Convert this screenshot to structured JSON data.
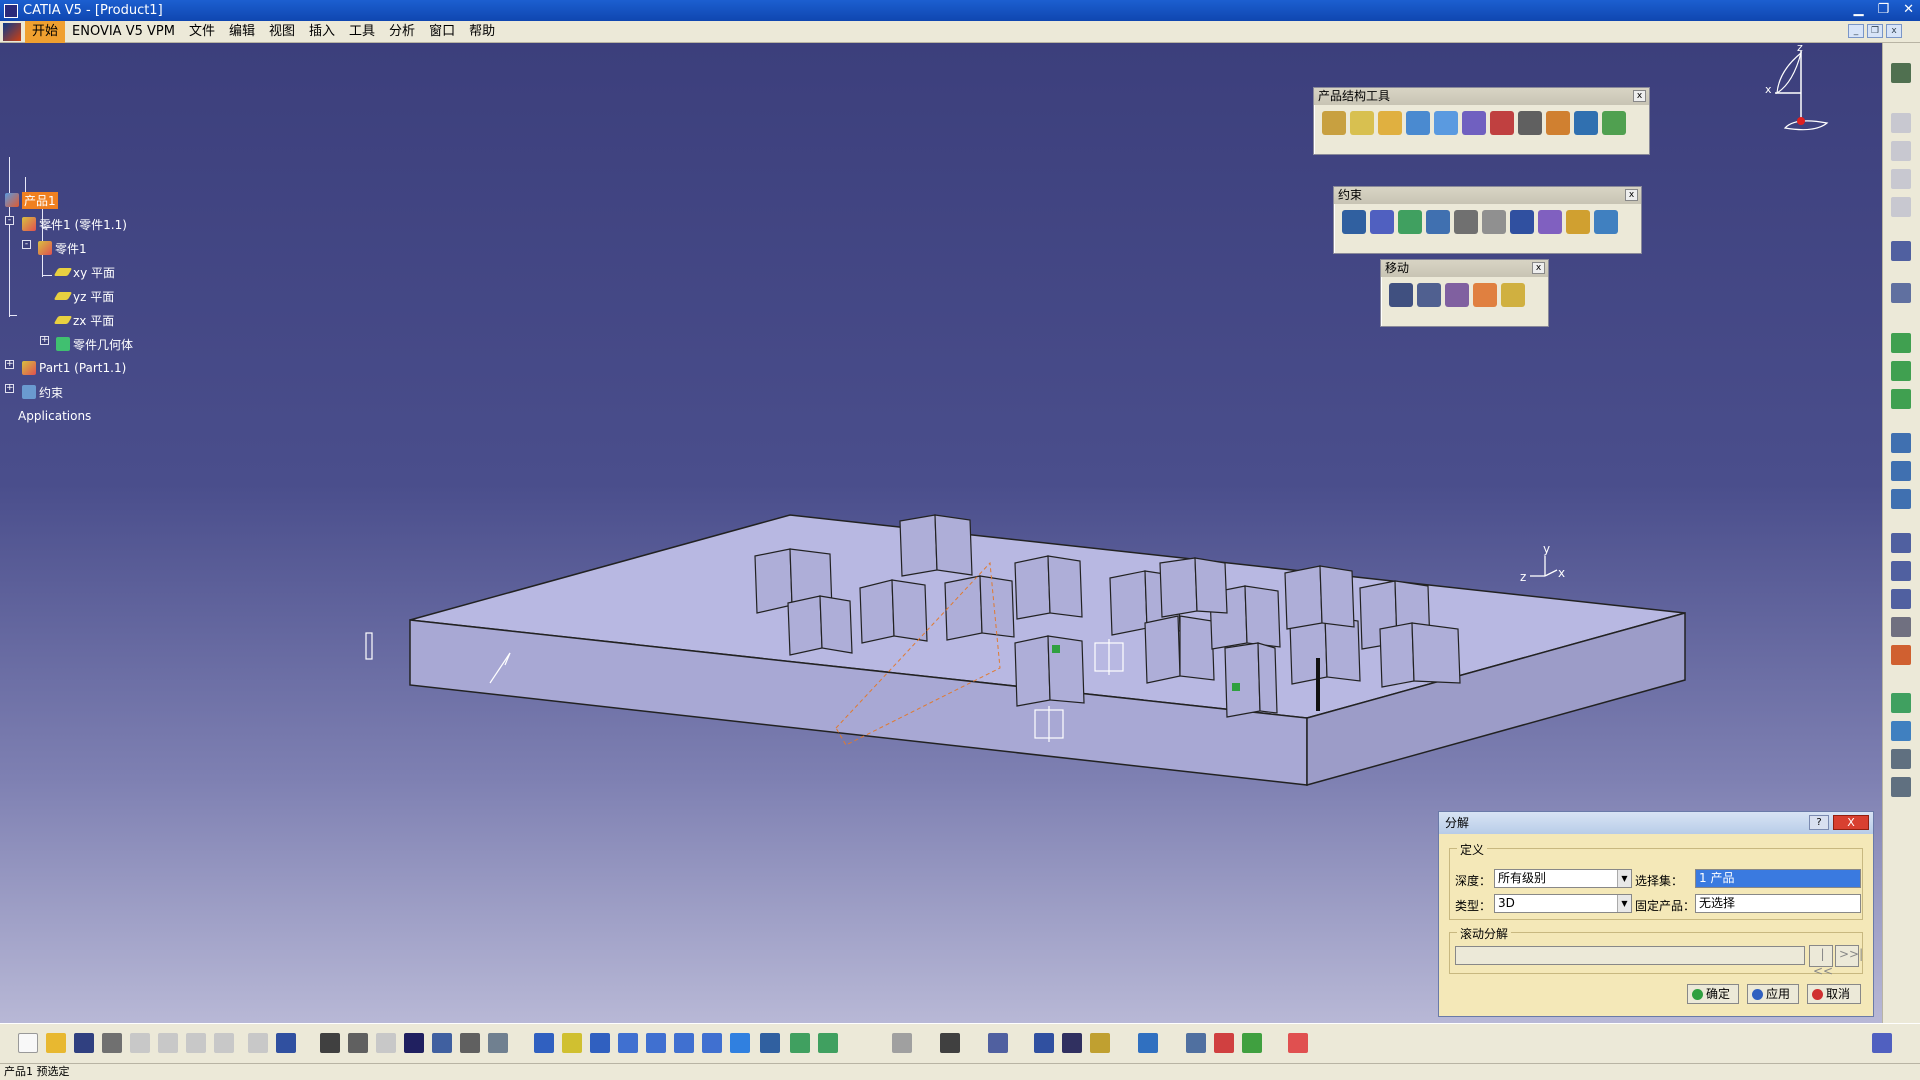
{
  "window": {
    "title": "CATIA V5 - [Product1]"
  },
  "menu": {
    "items": [
      "开始",
      "ENOVIA V5 VPM",
      "文件",
      "编辑",
      "视图",
      "插入",
      "工具",
      "分析",
      "窗口",
      "帮助"
    ]
  },
  "tree": {
    "root": "产品1",
    "child1": "零件1 (零件1.1)",
    "child1_sub": "零件1",
    "plane_xy": "xy 平面",
    "plane_yz": "yz 平面",
    "plane_zx": "zx 平面",
    "body": "零件几何体",
    "child2": "Part1 (Part1.1)",
    "constraints": "约束",
    "applications": "Applications"
  },
  "toolbars": {
    "product_structure": "产品结构工具",
    "constraints": "约束",
    "move": "移动"
  },
  "dialog": {
    "title": "分解",
    "definition": "定义",
    "depth_label": "深度：",
    "depth_value": "所有级别",
    "selection_label": "选择集：",
    "selection_value": "1 产品",
    "type_label": "类型：",
    "type_value": "3D",
    "fixed_label": "固定产品：",
    "fixed_value": "无选择",
    "scroll_label": "滚动分解",
    "ok": "确定",
    "apply": "应用",
    "cancel": "取消",
    "help": "?",
    "close": "X"
  },
  "compass": {
    "x": "x",
    "y": "y",
    "z": "z"
  },
  "status": "产品1 预选定",
  "colors": {
    "accent": "#f08020",
    "viewport_top": "#3c3f7c",
    "model": "#b8b8e0"
  }
}
